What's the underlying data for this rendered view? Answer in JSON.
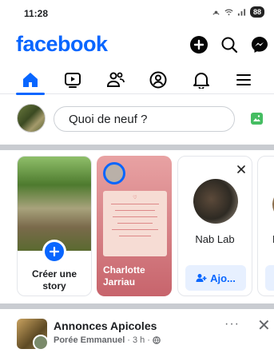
{
  "status": {
    "time": "11:28",
    "battery": "88"
  },
  "header": {
    "logo": "facebook"
  },
  "top_actions": [
    {
      "icon": "plus-circle-icon"
    },
    {
      "icon": "search-icon"
    },
    {
      "icon": "messenger-icon"
    }
  ],
  "tabs": [
    {
      "icon": "home-icon",
      "active": true
    },
    {
      "icon": "video-icon"
    },
    {
      "icon": "friends-icon"
    },
    {
      "icon": "profile-icon"
    },
    {
      "icon": "bell-icon"
    },
    {
      "icon": "menu-icon"
    }
  ],
  "composer": {
    "placeholder": "Quoi de neuf ?"
  },
  "stories": {
    "create_label": "Créer une story",
    "create_label_line1": "Créer une",
    "create_label_line2": "story",
    "charlotte_name": "Charlotte Jarriau",
    "charlotte_line1": "Charlotte",
    "charlotte_line2": "Jarriau",
    "nab_name": "Nab Lab",
    "nab_add_label": "Ajo...",
    "peek_letter": "E"
  },
  "post": {
    "title": "Annonces Apicoles",
    "author": "Porée Emmanuel",
    "time": "3 h",
    "separator": "·",
    "more": "···",
    "close": "✕"
  },
  "colors": {
    "brand": "#0866ff",
    "photo": "#45bd62"
  }
}
